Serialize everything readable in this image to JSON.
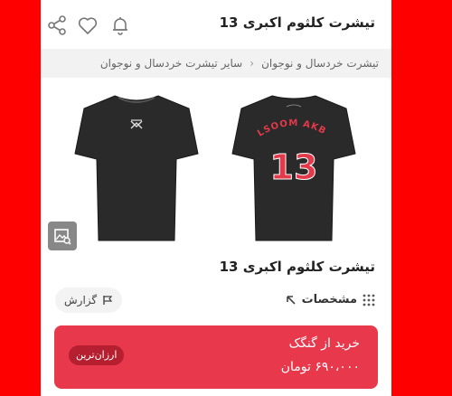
{
  "header": {
    "title": "تیشرت کلثوم اکبری 13",
    "icons": [
      "share-icon",
      "heart-icon",
      "bell-icon"
    ]
  },
  "breadcrumb": {
    "items": [
      "تیشرت خردسال و نوجوان",
      "سایر تیشرت خردسال و نوجوان"
    ]
  },
  "gallery": {
    "back_print": {
      "name": "KOLSOOM AKBARI",
      "number": "13"
    }
  },
  "product": {
    "title": "تیشرت کلثوم اکبری 13",
    "specs_label": "مشخصات",
    "report_label": "گزارش"
  },
  "buy": {
    "label": "خرید از گنگک",
    "price": "۶۹۰،۰۰۰ تومان",
    "badge": "ارزان‌ترین"
  },
  "colors": {
    "background": "#ff0000",
    "buy_box": "#e8394c",
    "badge": "#b51f2f",
    "shirt": "#2a2a2a",
    "print": "#e23a4a"
  }
}
